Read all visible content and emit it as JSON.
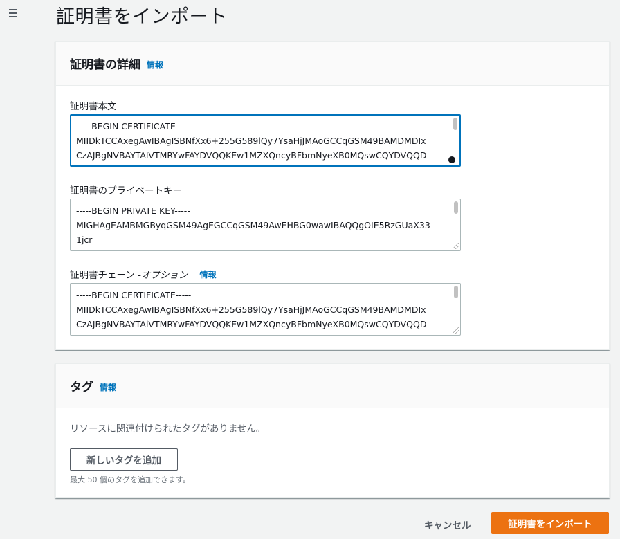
{
  "page": {
    "title": "証明書をインポート"
  },
  "details_panel": {
    "title": "証明書の詳細",
    "info": "情報",
    "body_field": {
      "label": "証明書本文",
      "lines": [
        "-----BEGIN CERTIFICATE-----",
        "MIIDkTCCAxegAwIBAgISBNfXx6+255G589lQy7YsaHjJMAoGCCqGSM49BAMDMDIx",
        "CzAJBgNVBAYTAlVTMRYwFAYDVQQKEw1MZXQncyBFbmNyeXB0MQswCQYDVQQD"
      ]
    },
    "key_field": {
      "label": "証明書のプライベートキー",
      "lines": [
        "-----BEGIN PRIVATE KEY-----",
        "MIGHAgEAMBMGByqGSM49AgEGCCqGSM49AwEHBG0wawIBAQQgOIE5RzGUaX33",
        "1jcr"
      ]
    },
    "chain_field": {
      "label_main": "証明書チェーン - ",
      "label_optional": "オプション",
      "info": "情報",
      "lines": [
        "-----BEGIN CERTIFICATE-----",
        "MIIDkTCCAxegAwIBAgISBNfXx6+255G589lQy7YsaHjJMAoGCCqGSM49BAMDMDIx",
        "CzAJBgNVBAYTAlVTMRYwFAYDVQQKEw1MZXQncyBFbmNyeXB0MQswCQYDVQQD"
      ]
    }
  },
  "tags_panel": {
    "title": "タグ",
    "info": "情報",
    "empty_text": "リソースに関連付けられたタグがありません。",
    "add_button": "新しいタグを追加",
    "hint": "最大 50 個のタグを追加できます。"
  },
  "footer": {
    "cancel": "キャンセル",
    "import": "証明書をインポート"
  },
  "colors": {
    "link": "#0073bb",
    "primary": "#ec7211",
    "focus": "#0073bb"
  }
}
